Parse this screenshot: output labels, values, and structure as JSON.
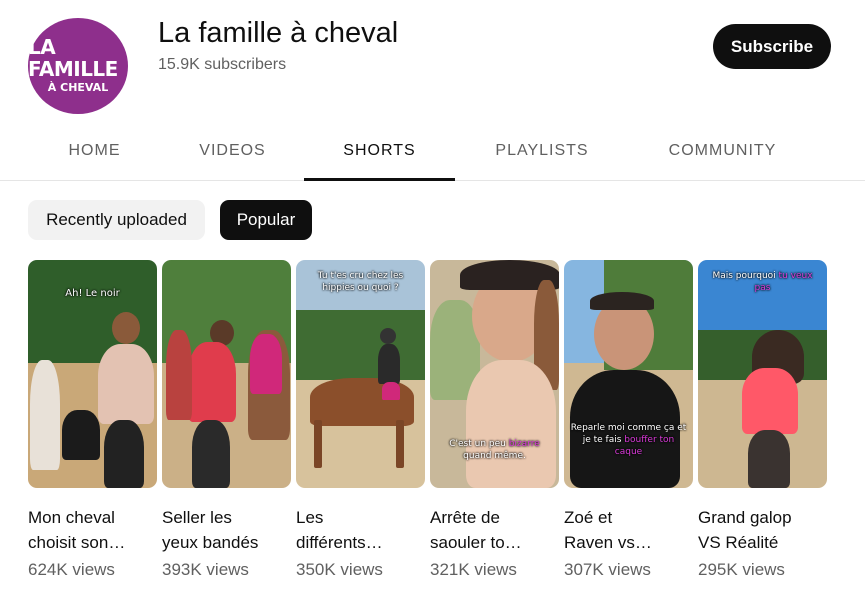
{
  "channel": {
    "avatar_line1": "LA FAMILLE",
    "avatar_line2": "À CHEVAL",
    "name": "La famille à cheval",
    "subscribers": "15.9K subscribers",
    "subscribe_label": "Subscribe"
  },
  "tabs": [
    {
      "label": "HOME"
    },
    {
      "label": "VIDEOS"
    },
    {
      "label": "SHORTS"
    },
    {
      "label": "PLAYLISTS"
    },
    {
      "label": "COMMUNITY"
    }
  ],
  "active_tab": "SHORTS",
  "chips": [
    {
      "label": "Recently uploaded"
    },
    {
      "label": "Popular"
    }
  ],
  "active_chip": "Popular",
  "shorts": [
    {
      "title_l1": "Mon cheval",
      "title_l2": "choisit son…",
      "views": "624K views",
      "caption_pre": "Ah! Le noir",
      "caption_accent": "",
      "caption_post": ""
    },
    {
      "title_l1": "Seller les",
      "title_l2": "yeux bandés",
      "views": "393K views",
      "caption_pre": "",
      "caption_accent": "",
      "caption_post": ""
    },
    {
      "title_l1": "Les",
      "title_l2": "différents…",
      "views": "350K views",
      "caption_pre": "Tu t'es cru chez les hippies ou quoi ?",
      "caption_accent": "",
      "caption_post": ""
    },
    {
      "title_l1": "Arrête de",
      "title_l2": "saouler to…",
      "views": "321K views",
      "caption_pre": "C'est un peu",
      "caption_accent": "bizarre",
      "caption_post": "quand même."
    },
    {
      "title_l1": "Zoé et",
      "title_l2": "Raven vs…",
      "views": "307K views",
      "caption_pre": "Reparle moi comme ça et je te fais",
      "caption_accent": "bouffer ton caque",
      "caption_post": ""
    },
    {
      "title_l1": "Grand galop",
      "title_l2": "VS Réalité",
      "views": "295K views",
      "caption_pre": "Mais pourquoi",
      "caption_accent": "tu veux pas",
      "caption_post": ""
    }
  ],
  "colors": {
    "avatar_bg": "#8e2f8c",
    "accent_caption": "#d93ad8",
    "primary_text": "#0f0f0f",
    "secondary_text": "#606060"
  }
}
